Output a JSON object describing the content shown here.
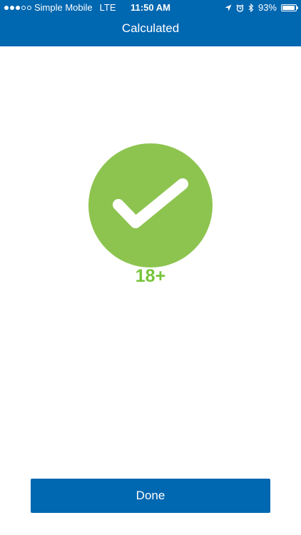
{
  "status_bar": {
    "carrier": "Simple Mobile",
    "network": "LTE",
    "time": "11:50 AM",
    "battery_percent": "93%",
    "battery_level": 0.93,
    "signal_bars_filled": 3,
    "signal_bars_total": 5
  },
  "nav": {
    "title": "Calculated"
  },
  "result": {
    "label": "18+",
    "icon": "checkmark-icon",
    "circle_color": "#8dc44f",
    "label_color": "#76c43a"
  },
  "footer": {
    "done_label": "Done"
  },
  "colors": {
    "brand_blue": "#0067b1"
  }
}
